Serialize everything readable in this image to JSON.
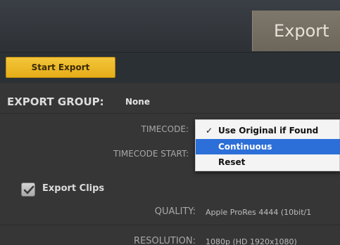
{
  "header": {
    "export_tab": "Export"
  },
  "toolbar": {
    "start_export": "Start Export"
  },
  "export_group": {
    "label": "EXPORT GROUP:",
    "value": "None"
  },
  "timecode": {
    "label": "TIMECODE:",
    "options": [
      {
        "label": "Use Original if Found",
        "checked": true,
        "highlighted": false
      },
      {
        "label": "Continuous",
        "checked": false,
        "highlighted": true
      },
      {
        "label": "Reset",
        "checked": false,
        "highlighted": false
      }
    ],
    "check_mark": "✓"
  },
  "timecode_start": {
    "label": "TIMECODE START:"
  },
  "export_clips": {
    "label": "Export Clips",
    "checked": true
  },
  "quality": {
    "label": "QUALITY:",
    "value": "Apple ProRes 4444 (10bit/1"
  },
  "resolution": {
    "label": "RESOLUTION:",
    "value": "1080p (HD 1920x1080)"
  },
  "colors": {
    "accent": "#f0bf30",
    "highlight": "#2d6fd8",
    "tab": "#7a7468"
  }
}
